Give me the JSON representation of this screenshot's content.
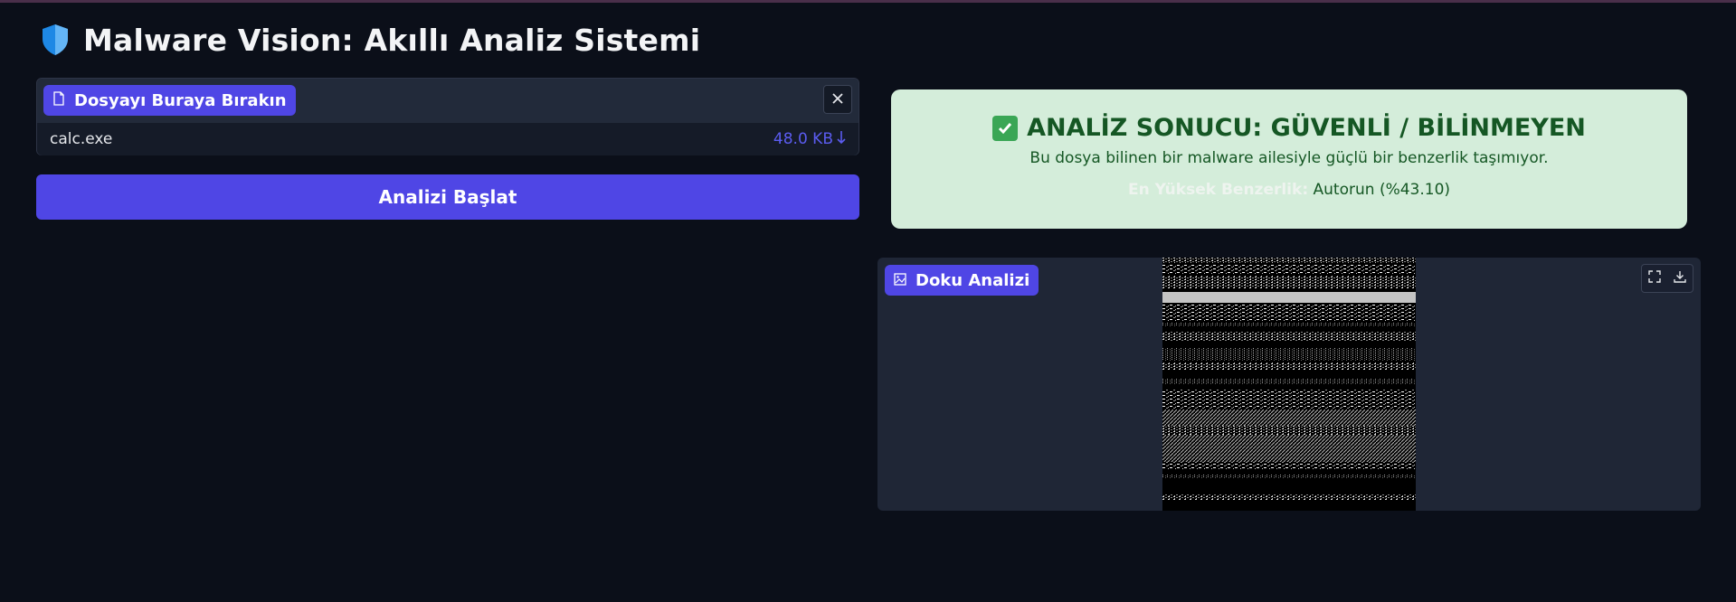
{
  "app": {
    "title": "Malware Vision: Akıllı Analiz Sistemi",
    "icon": "shield-icon",
    "accent_color": "#4f46e5"
  },
  "upload": {
    "label": "Dosyayı Buraya Bırakın",
    "label_icon": "file-icon",
    "close_icon": "close-icon",
    "file_name": "calc.exe",
    "file_size": "48.0 KB",
    "download_icon": "download-arrow-icon"
  },
  "analyze_button": {
    "label": "Analizi Başlat"
  },
  "result": {
    "status_icon": "check-icon",
    "title": "ANALİZ SONUCU: GÜVENLİ / BİLİNMEYEN",
    "description": "Bu dosya bilinen bir malware ailesiyle güçlü bir benzerlik taşımıyor.",
    "similarity_label": "En Yüksek Benzerlik:",
    "similarity_value": "Autorun (%43.10)",
    "background_color": "#d4edda",
    "text_color": "#155724"
  },
  "texture": {
    "label": "Doku Analizi",
    "label_icon": "image-icon",
    "fullscreen_icon": "fullscreen-icon",
    "download_icon": "download-icon"
  }
}
